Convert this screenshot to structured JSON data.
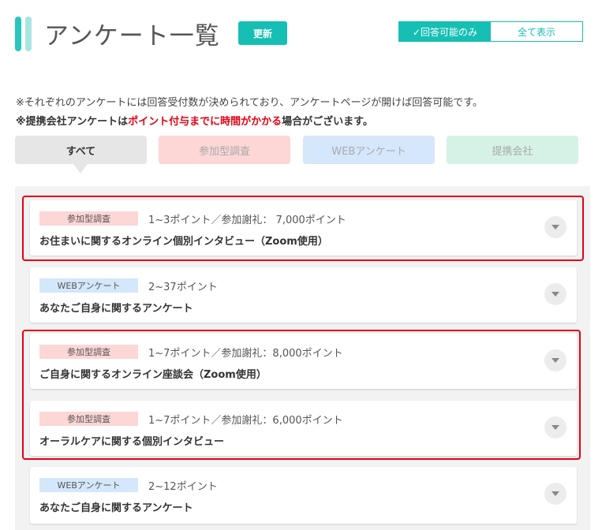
{
  "page": {
    "title": "アンケート一覧",
    "update_label": "更新",
    "toggle": {
      "answerable_only": "✓回答可能のみ",
      "show_all": "全て表示"
    }
  },
  "notes": {
    "line1": "※それぞれのアンケートには回答受付数が決められており、アンケートページが開けば回答可能です。",
    "line2_pre": "※提携会社アンケートは",
    "line2_red": "ポイント付与までに時間がかかる",
    "line2_post": "場合がございます。"
  },
  "filter_tabs": {
    "all": "すべて",
    "sanka": "参加型調査",
    "web": "WEBアンケート",
    "teikei": "提携会社"
  },
  "surveys": [
    {
      "badge": "参加型調査",
      "points": "1~3ポイント／参加謝礼： 7,000ポイント",
      "title": "お住まいに関するオンライン個別インタビュー（Zoom使用）"
    },
    {
      "badge": "WEBアンケート",
      "points": "2~37ポイント",
      "title": "あなたご自身に関するアンケート"
    },
    {
      "badge": "参加型調査",
      "points": "1~7ポイント／参加謝礼：8,000ポイント",
      "title": "ご自身に関するオンライン座談会（Zoom使用）"
    },
    {
      "badge": "参加型調査",
      "points": "1~7ポイント／参加謝礼：6,000ポイント",
      "title": "オーラルケアに関する個別インタビュー"
    },
    {
      "badge": "WEBアンケート",
      "points": "2~12ポイント",
      "title": "あなたご自身に関するアンケート"
    }
  ],
  "colors": {
    "accent": "#16bfb3",
    "highlight": "#e60012",
    "sanka_badge": "#fdd6d6",
    "web_badge": "#d4e7fb",
    "teikei_tab": "#d4f2e5"
  }
}
